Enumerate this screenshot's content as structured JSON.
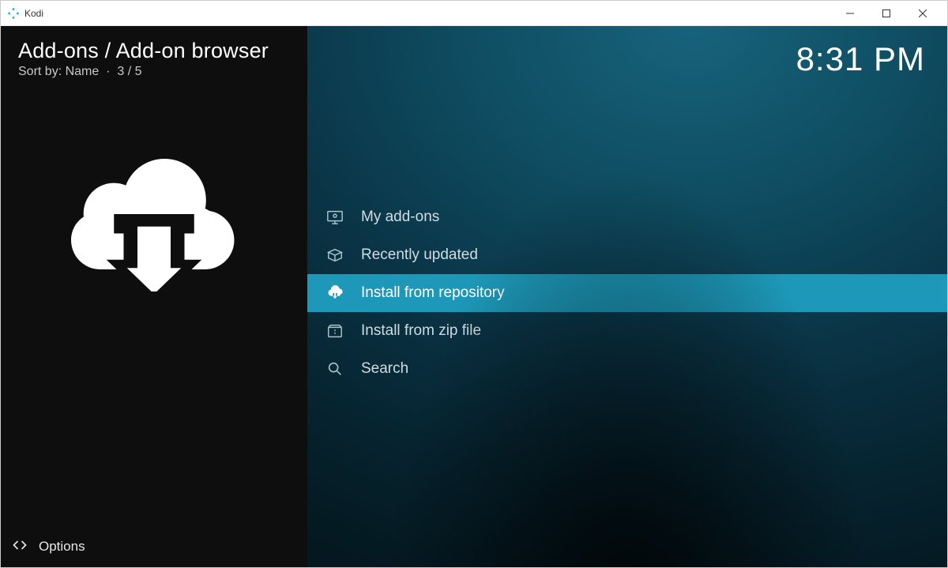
{
  "titlebar": {
    "app_name": "Kodi"
  },
  "header": {
    "breadcrumb": "Add-ons / Add-on browser",
    "sort_prefix": "Sort by: ",
    "sort_value": "Name",
    "position": "3 / 5"
  },
  "clock": "8:31 PM",
  "menu": {
    "items": [
      {
        "label": "My add-ons",
        "icon": "monitor-icon",
        "selected": false
      },
      {
        "label": "Recently updated",
        "icon": "box-open-icon",
        "selected": false
      },
      {
        "label": "Install from repository",
        "icon": "cloud-download-icon",
        "selected": true
      },
      {
        "label": "Install from zip file",
        "icon": "zip-file-icon",
        "selected": false
      },
      {
        "label": "Search",
        "icon": "search-icon",
        "selected": false
      }
    ]
  },
  "footer": {
    "options_label": "Options"
  }
}
